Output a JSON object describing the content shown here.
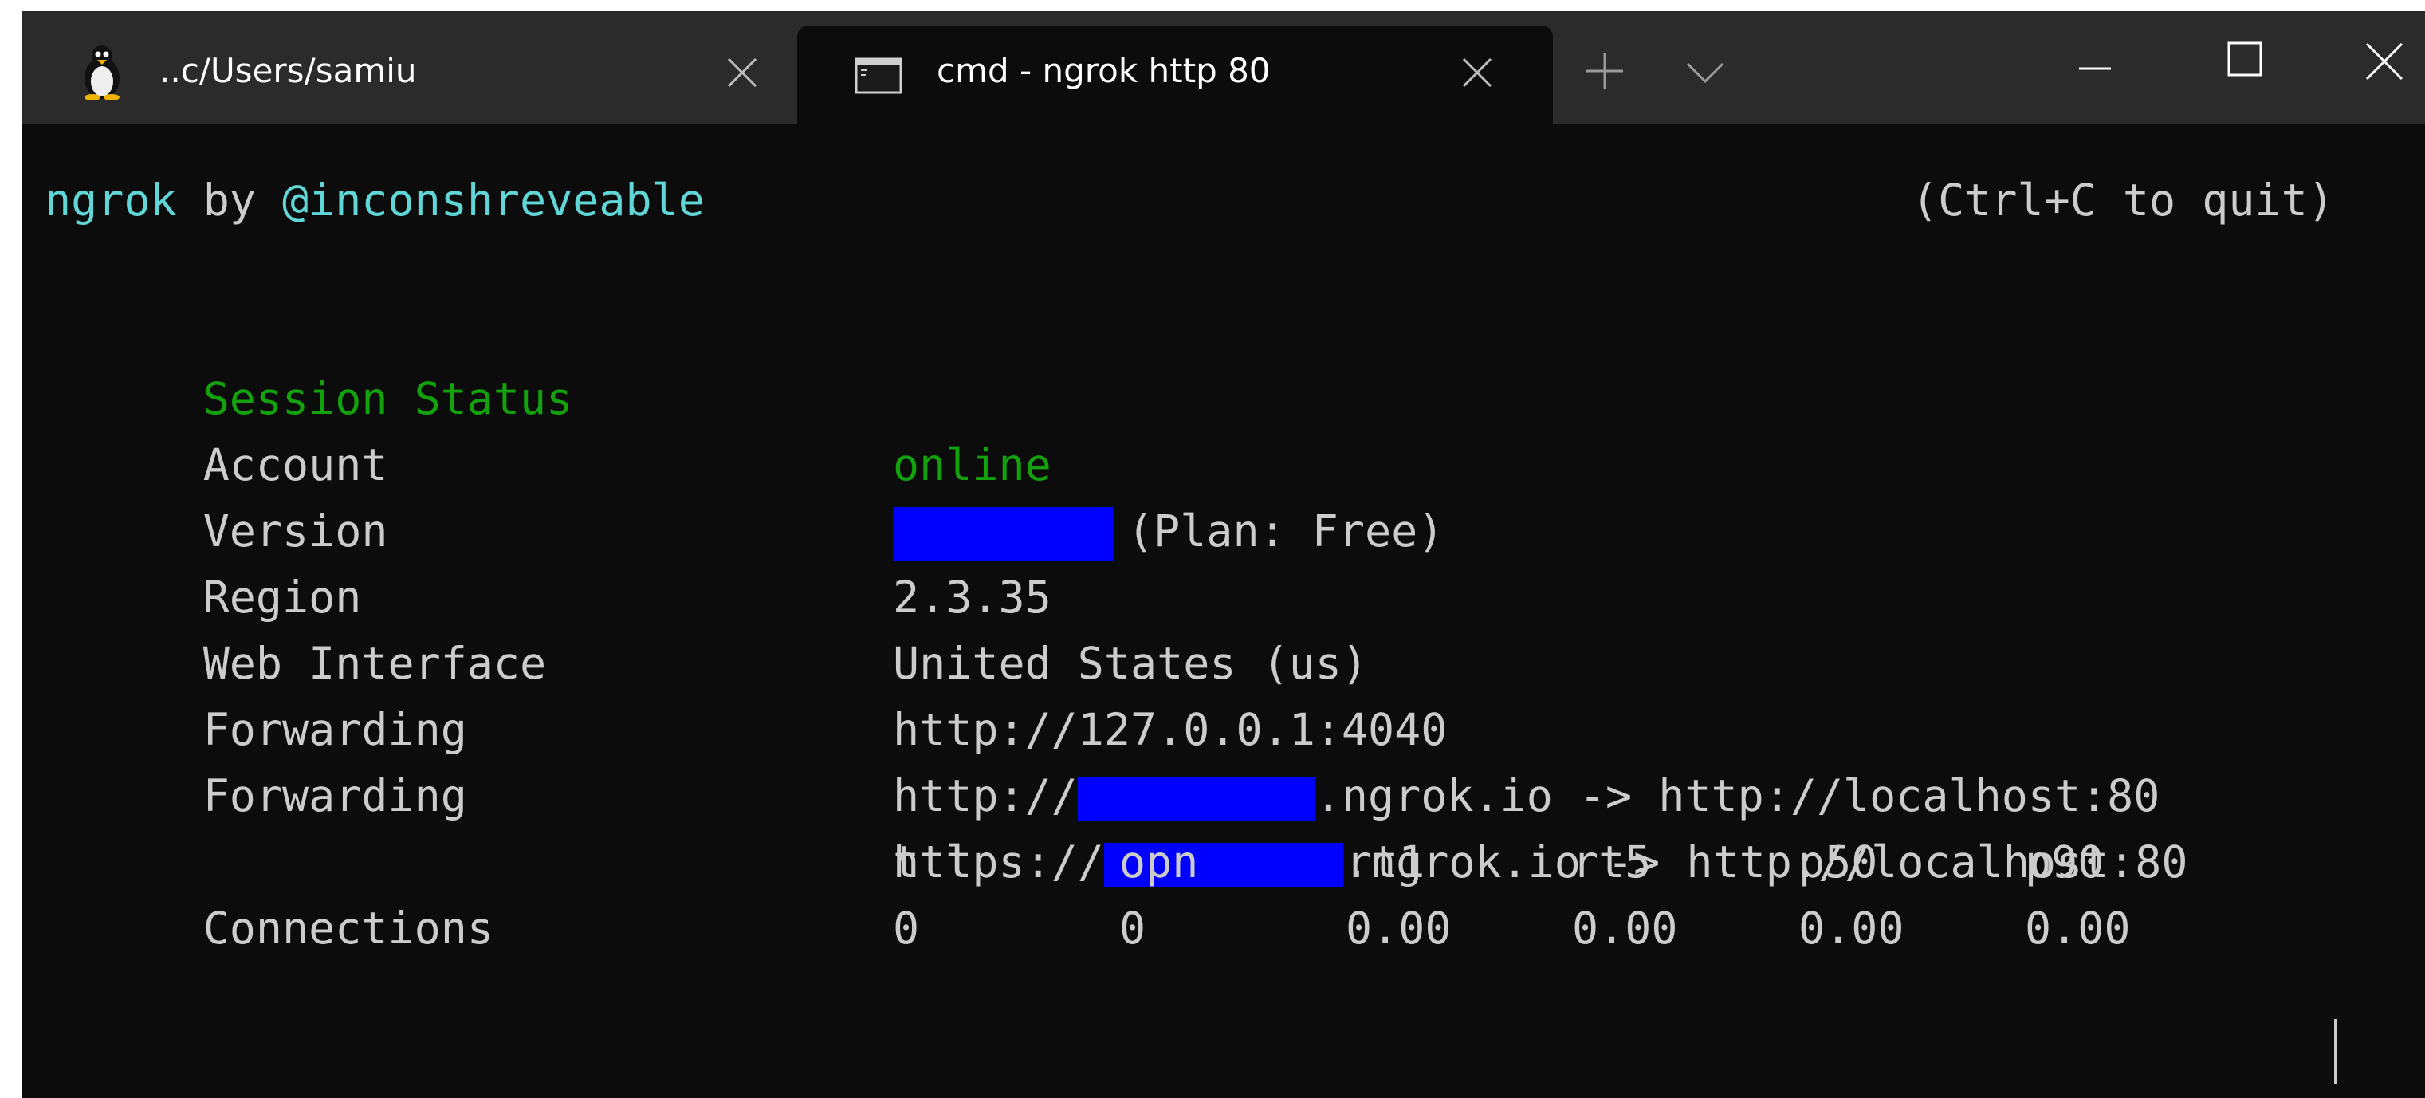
{
  "tabs": [
    {
      "label": "..c/Users/samiu",
      "icon": "linux-penguin-icon"
    },
    {
      "label": "cmd - ngrok  http 80",
      "icon": "cmd-console-icon"
    }
  ],
  "terminal": {
    "brand": "ngrok",
    "by": " by ",
    "author": "@inconshreveable",
    "quit_hint": "(Ctrl+C to quit)",
    "rows": {
      "session_status": {
        "label": "Session Status",
        "value": "online"
      },
      "account": {
        "label": "Account",
        "value": "(Plan: Free)"
      },
      "version": {
        "label": "Version",
        "value": "2.3.35"
      },
      "region": {
        "label": "Region",
        "value": "United States (us)"
      },
      "web_interface": {
        "label": "Web Interface",
        "value": "http://127.0.0.1:4040"
      },
      "forwarding_http": {
        "label": "Forwarding",
        "prefix": "http://",
        "suffix": ".ngrok.io -> http://localhost:80"
      },
      "forwarding_https": {
        "label": "Forwarding",
        "prefix": "https://",
        "suffix": ".ngrok.io -> http://localhost:80"
      }
    },
    "connections": {
      "label": "Connections",
      "headers": [
        "ttl",
        "opn",
        "rt1",
        "rt5",
        "p50",
        "p90"
      ],
      "values": [
        "0",
        "0",
        "0.00",
        "0.00",
        "0.00",
        "0.00"
      ]
    }
  },
  "colors": {
    "terminal_bg": "#0c0c0c",
    "titlebar_bg": "#2b2b2b",
    "cyan": "#61d6d6",
    "green": "#13a10e",
    "redaction": "#0000ff"
  }
}
